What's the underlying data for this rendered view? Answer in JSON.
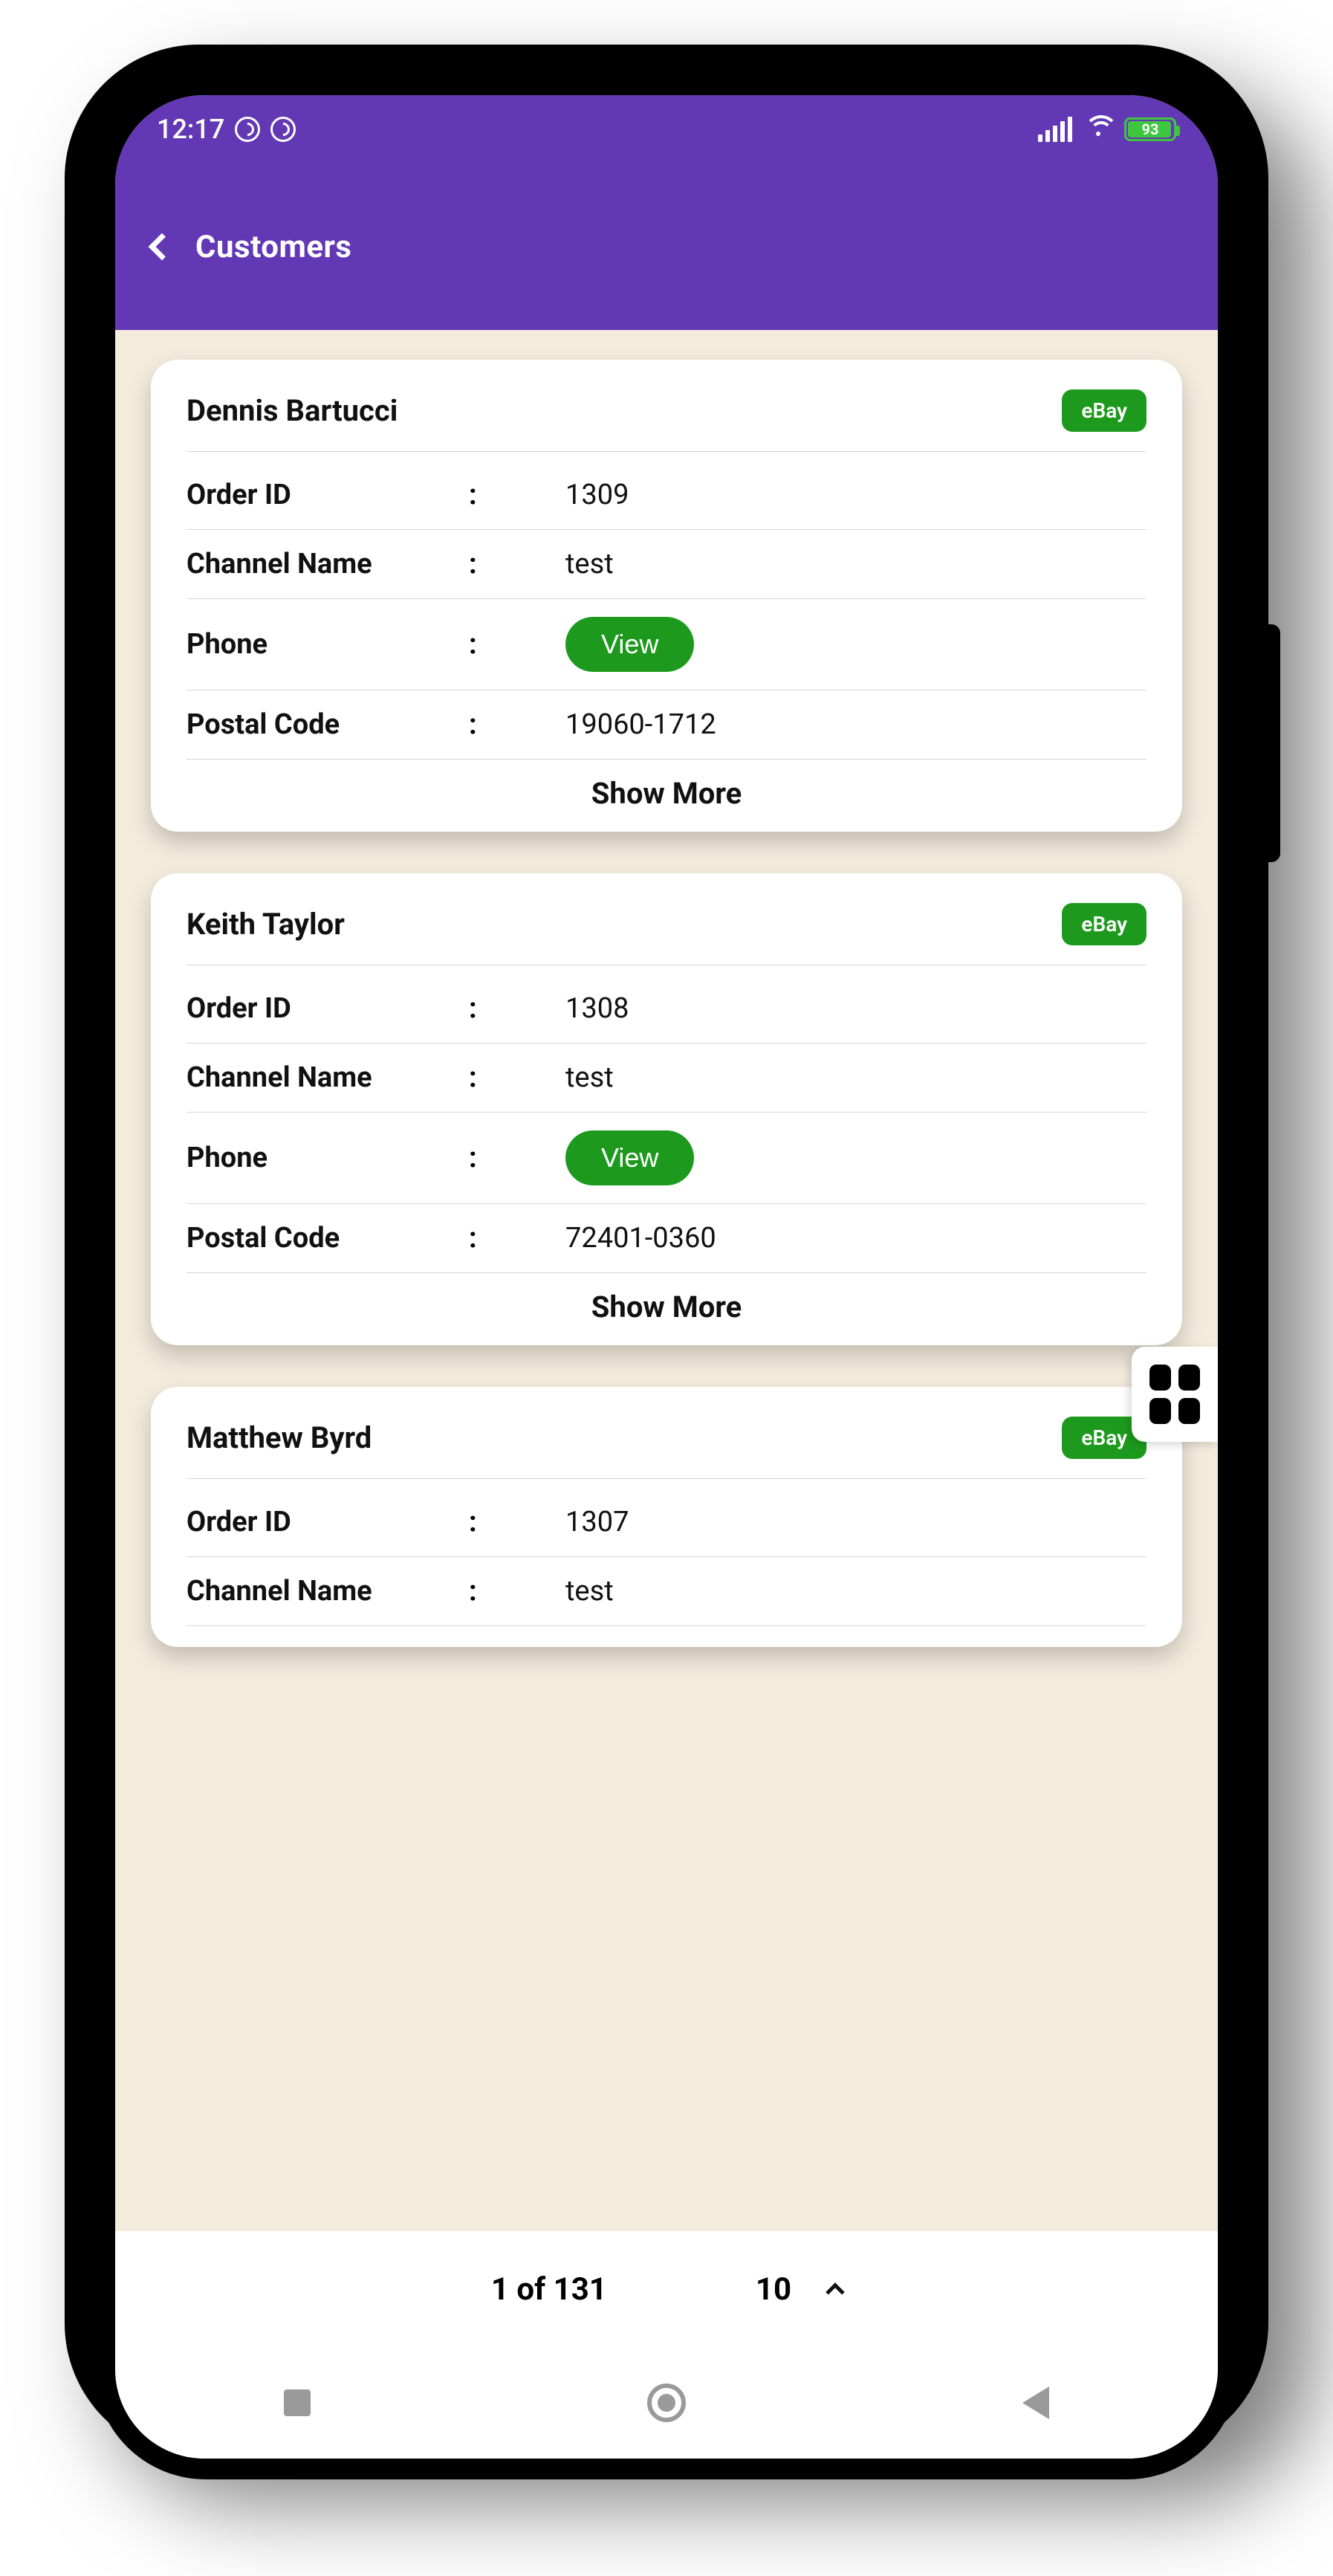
{
  "status": {
    "time": "12:17",
    "battery": "93"
  },
  "header": {
    "title": "Customers"
  },
  "labels": {
    "order_id": "Order ID",
    "channel_name": "Channel Name",
    "phone": "Phone",
    "postal_code": "Postal Code",
    "show_more": "Show More",
    "view": "View",
    "colon": ":"
  },
  "customers": [
    {
      "name": "Dennis Bartucci",
      "badge": "eBay",
      "order_id": "1309",
      "channel_name": "test",
      "postal_code": "19060-1712"
    },
    {
      "name": "Keith Taylor",
      "badge": "eBay",
      "order_id": "1308",
      "channel_name": "test",
      "postal_code": "72401-0360"
    },
    {
      "name": "Matthew Byrd",
      "badge": "eBay",
      "order_id": "1307",
      "channel_name": "test",
      "postal_code": ""
    }
  ],
  "pagination": {
    "text": "1 of 131",
    "page_size": "10"
  }
}
